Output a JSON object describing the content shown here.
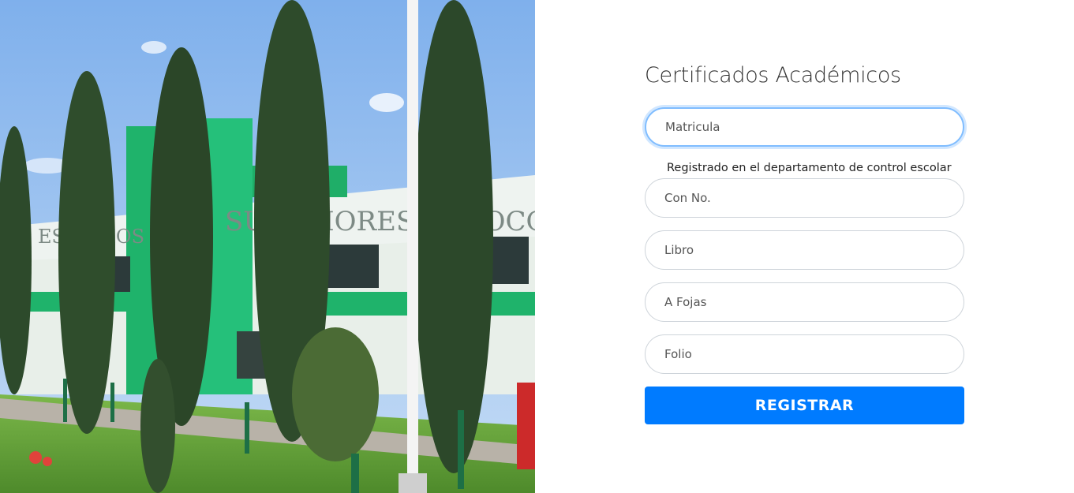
{
  "hero_image": {
    "sign_text_1": "ESTUDIOS",
    "sign_text_2": "SUPERIORES DE JOCOTITLÁN",
    "colors": {
      "sky": "#9cc2f0",
      "building_green": "#1fb36b",
      "cypress": "#2d4a2b",
      "grass": "#6ca93f"
    }
  },
  "form": {
    "title": "Certificados Académicos",
    "fields": {
      "matricula": {
        "placeholder": "Matricula",
        "value": ""
      },
      "con_no": {
        "placeholder": "Con No.",
        "value": ""
      },
      "libro": {
        "placeholder": "Libro",
        "value": ""
      },
      "a_fojas": {
        "placeholder": "A Fojas",
        "value": ""
      },
      "folio": {
        "placeholder": "Folio",
        "value": ""
      }
    },
    "helper_text": "Registrado en el departamento de control escolar",
    "submit_label": "REGISTRAR"
  },
  "colors": {
    "primary": "#007bff",
    "focus_ring": "#80bdff"
  }
}
